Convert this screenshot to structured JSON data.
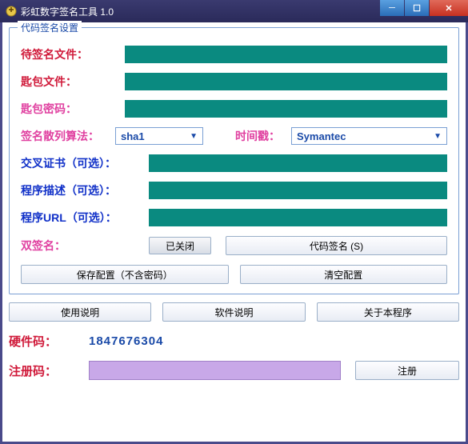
{
  "window": {
    "title": "彩虹数字签名工具 1.0"
  },
  "group": {
    "legend": "代码签名设置",
    "file_to_sign_label": "待签名文件：",
    "file_to_sign_value": "",
    "keyfile_label": "匙包文件：",
    "keyfile_value": "",
    "keypass_label": "匙包密码：",
    "keypass_value": "",
    "hash_label": "签名散列算法：",
    "hash_value": "sha1",
    "timestamp_label": "时间戳：",
    "timestamp_value": "Symantec",
    "cross_cert_label": "交叉证书（可选）：",
    "cross_cert_value": "",
    "desc_label": "程序描述（可选）：",
    "desc_value": "",
    "url_label": "程序URL（可选）：",
    "url_value": "",
    "dualsign_label": "双签名：",
    "dualsign_toggle": "已关闭",
    "codesign_btn": "代码签名 (S)",
    "save_cfg_btn": "保存配置（不含密码）",
    "clear_cfg_btn": "清空配置"
  },
  "bottom": {
    "usage_btn": "使用说明",
    "software_btn": "软件说明",
    "about_btn": "关于本程序",
    "hwid_label": "硬件码：",
    "hwid_value": "1847676304",
    "regcode_label": "注册码：",
    "regcode_value": "",
    "register_btn": "注册"
  }
}
